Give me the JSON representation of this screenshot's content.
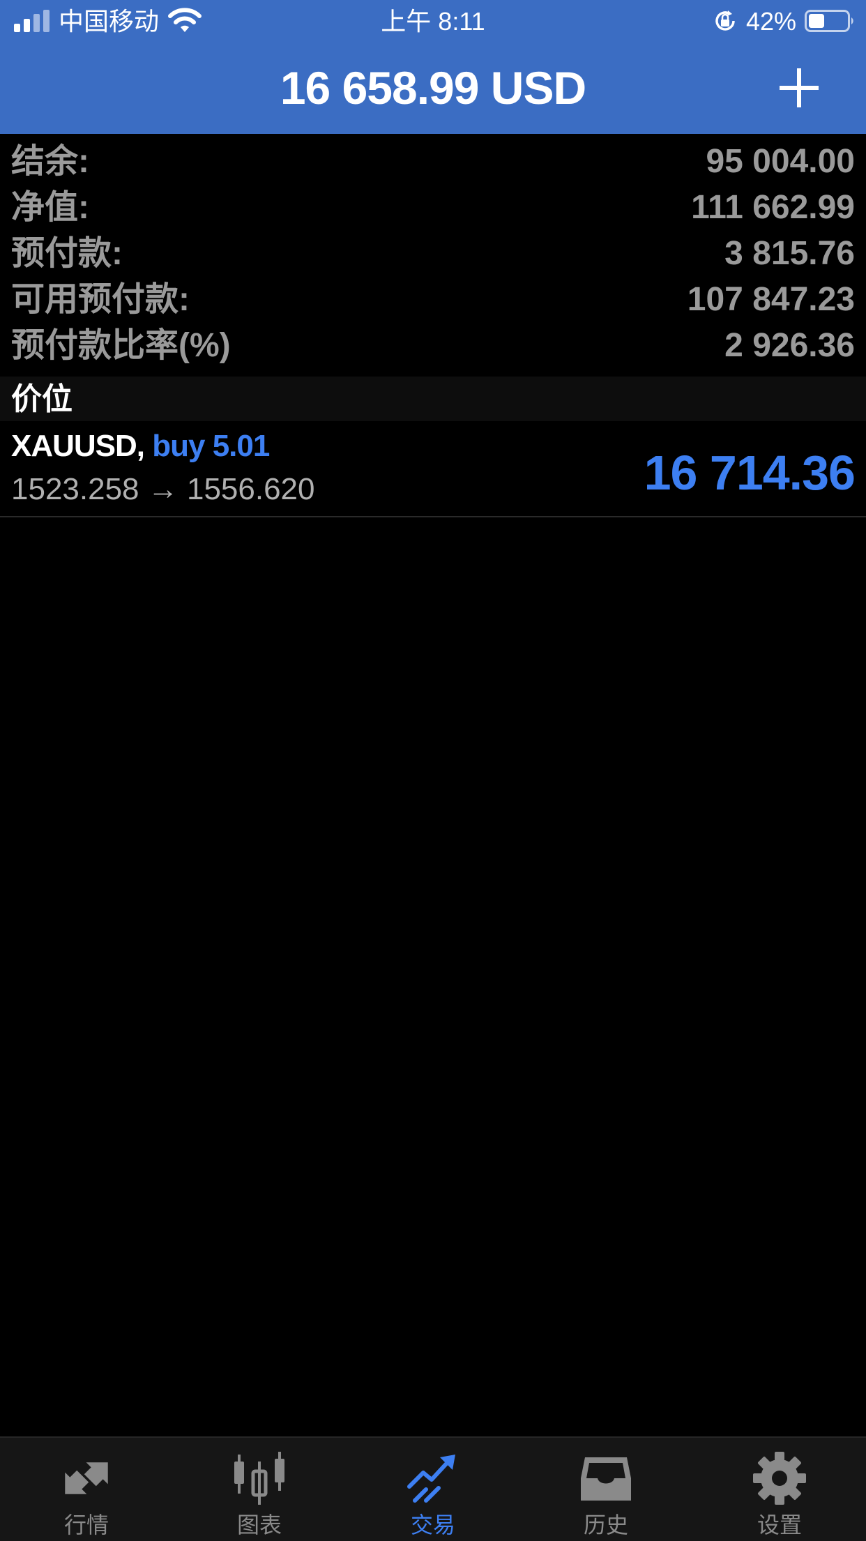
{
  "status_bar": {
    "carrier": "中国移动",
    "time": "上午 8:11",
    "battery_percent": "42%",
    "battery_level": 0.42
  },
  "header": {
    "title": "16 658.99 USD",
    "add_icon": "plus-icon"
  },
  "summary": [
    {
      "label": "结余:",
      "value": "95 004.00"
    },
    {
      "label": "净值:",
      "value": "111 662.99"
    },
    {
      "label": "预付款:",
      "value": "3 815.76"
    },
    {
      "label": "可用预付款:",
      "value": "107 847.23"
    },
    {
      "label": "预付款比率(%)",
      "value": "2 926.36"
    }
  ],
  "positions_section": {
    "title": "价位"
  },
  "positions": [
    {
      "symbol": "XAUUSD,",
      "side": "buy 5.01",
      "prices": "1523.258 → 1556.620",
      "profit": "16 714.36"
    }
  ],
  "tabs": [
    {
      "label": "行情",
      "icon": "quotes-arrows-icon",
      "active": false
    },
    {
      "label": "图表",
      "icon": "candlestick-chart-icon",
      "active": false
    },
    {
      "label": "交易",
      "icon": "trade-trend-icon",
      "active": true
    },
    {
      "label": "历史",
      "icon": "history-inbox-icon",
      "active": false
    },
    {
      "label": "设置",
      "icon": "gear-icon",
      "active": false
    }
  ],
  "colors": {
    "header_blue": "#3b6dc3",
    "accent_blue": "#3d7ff2",
    "muted_gray": "#9a9a9a",
    "background": "#000000",
    "tabbar": "#161616"
  }
}
